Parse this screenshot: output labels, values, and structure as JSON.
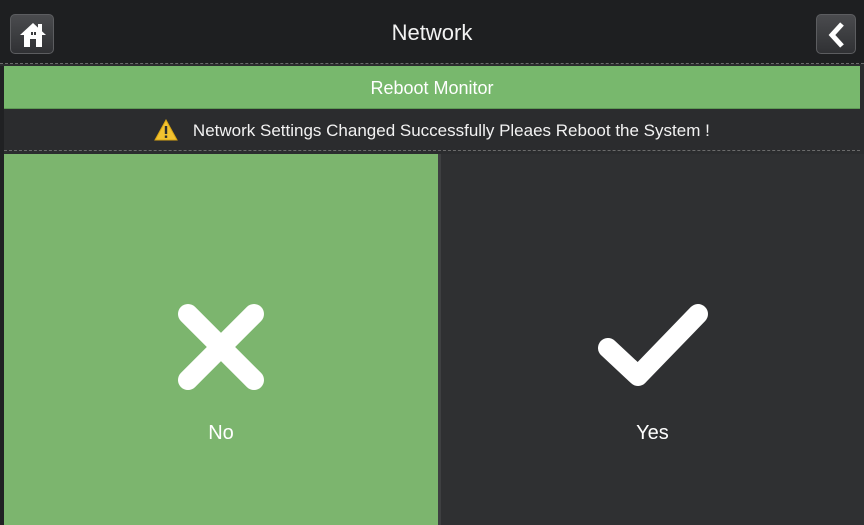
{
  "header": {
    "title": "Network",
    "home_icon": "home-icon",
    "back_icon": "chevron-left-icon"
  },
  "subtitle": {
    "text": "Reboot Monitor"
  },
  "message": {
    "icon": "warning-icon",
    "text": "Network Settings Changed Successfully Pleaes Reboot the System !"
  },
  "choices": {
    "no": {
      "label": "No",
      "icon": "close-icon"
    },
    "yes": {
      "label": "Yes",
      "icon": "check-icon"
    }
  },
  "colors": {
    "accent_green": "#78b86d",
    "panel_dark": "#2f3032",
    "warning_yellow": "#f2c230"
  }
}
